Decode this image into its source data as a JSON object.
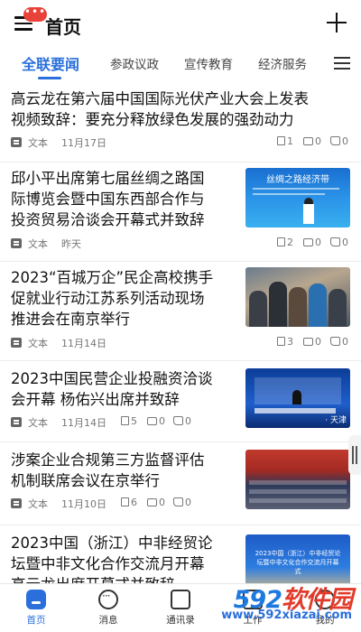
{
  "header": {
    "title": "首页",
    "badge": "•••",
    "icons": {
      "menu": "menu-icon",
      "add": "plus-icon"
    }
  },
  "tabs": [
    {
      "label": "全联要闻",
      "active": true
    },
    {
      "label": "参政议政",
      "active": false
    },
    {
      "label": "宣传教育",
      "active": false
    },
    {
      "label": "经济服务",
      "active": false
    }
  ],
  "articles": [
    {
      "title_lines": [
        "高云龙在第六届中国国际光伏产业大会上发表",
        "视频致辞：要充分释放绿色发展的强劲动力"
      ],
      "type": "文本",
      "date": "11月17日",
      "pages": "1",
      "comments": "0",
      "likes": "0",
      "has_thumb": false
    },
    {
      "title_lines": [
        "邱小平出席第七届丝绸之路国",
        "际博览会暨中国东西部合作与",
        "投资贸易洽谈会开幕式并致辞"
      ],
      "type": "文本",
      "date": "昨天",
      "pages": "2",
      "comments": "0",
      "likes": "0",
      "has_thumb": true,
      "thumb_text": "丝绸之路经济带"
    },
    {
      "title_lines": [
        "2023“百城万企”民企高校携手",
        "促就业行动江苏系列活动现场",
        "推进会在南京举行"
      ],
      "type": "文本",
      "date": "11月14日",
      "pages": "3",
      "comments": "0",
      "likes": "0",
      "has_thumb": true
    },
    {
      "title_lines": [
        "2023中国民营企业投融资洽谈",
        "会开幕 杨佑兴出席并致辞"
      ],
      "type": "文本",
      "date": "11月14日",
      "pages": "5",
      "comments": "0",
      "likes": "0",
      "has_thumb": true,
      "thumb_text": "· 天津"
    },
    {
      "title_lines": [
        "涉案企业合规第三方监督评估",
        "机制联席会议在京举行"
      ],
      "type": "文本",
      "date": "11月10日",
      "pages": "6",
      "comments": "0",
      "likes": "0",
      "has_thumb": true
    },
    {
      "title_lines": [
        "2023中国（浙江）中非经贸论",
        "坛暨中非文化合作交流月开幕",
        "高云龙出席开幕式并致辞"
      ],
      "has_thumb": true,
      "thumb_text": "2023中国（浙江）中非经贸论坛暨中非文化合作交流月开幕式"
    }
  ],
  "bottom_nav": [
    {
      "label": "首页",
      "icon": "home-icon",
      "active": true
    },
    {
      "label": "消息",
      "icon": "message-icon",
      "active": false
    },
    {
      "label": "通讯录",
      "icon": "contacts-icon",
      "active": false
    },
    {
      "label": "工作",
      "icon": "work-icon",
      "active": false
    },
    {
      "label": "我的",
      "icon": "user-icon",
      "active": false
    }
  ],
  "watermark": {
    "logo_num": "592",
    "logo_cn": "软件园",
    "url": "www.592xiazai.com"
  },
  "colors": {
    "accent": "#2a6fdb",
    "badge": "#e8423a",
    "watermark_blue": "#1f7adf",
    "watermark_red": "#e23b2b"
  }
}
